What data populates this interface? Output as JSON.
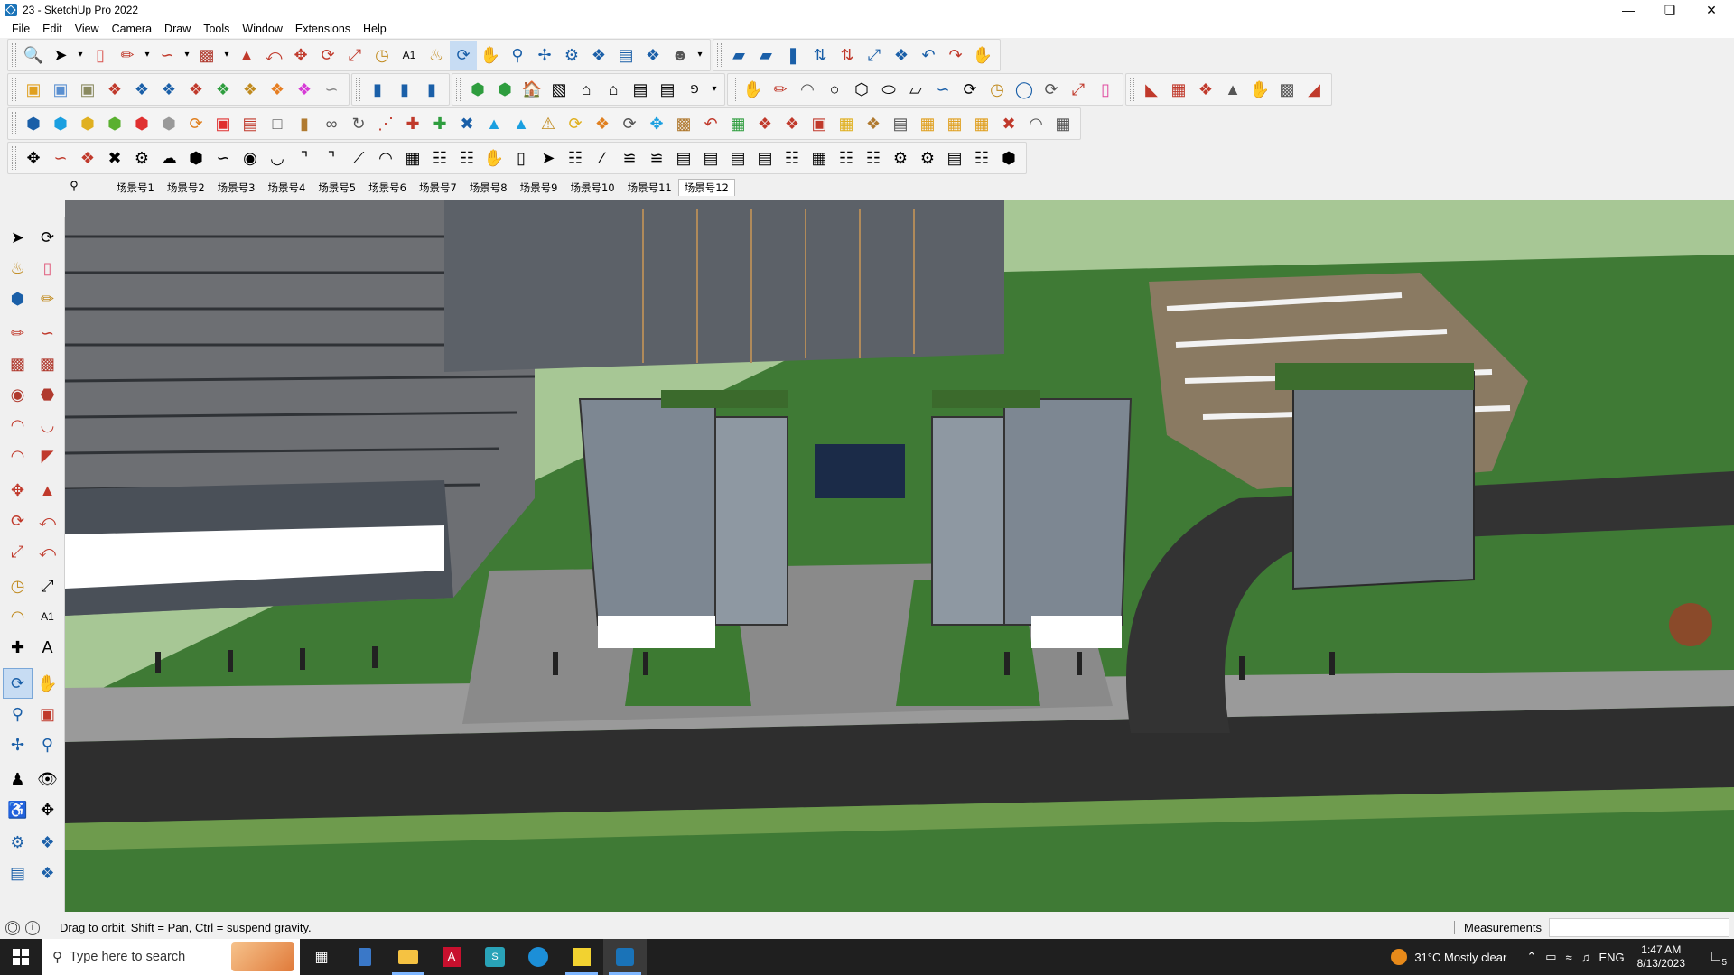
{
  "window": {
    "title": "23 - SketchUp Pro 2022",
    "controls": [
      "minimize-icon",
      "restore-icon",
      "close-icon"
    ]
  },
  "menu": [
    "File",
    "Edit",
    "View",
    "Camera",
    "Draw",
    "Tools",
    "Window",
    "Extensions",
    "Help"
  ],
  "scenes": {
    "search_icon": "search-icon",
    "tabs": [
      "场景号1",
      "场景号2",
      "场景号3",
      "场景号4",
      "场景号5",
      "场景号6",
      "场景号7",
      "场景号8",
      "场景号9",
      "场景号10",
      "场景号11",
      "场景号12"
    ],
    "active": "场景号12"
  },
  "status": {
    "hint": "Drag to orbit. Shift = Pan, Ctrl = suspend gravity.",
    "measurements_label": "Measurements",
    "measurements_value": ""
  },
  "taskbar": {
    "search_placeholder": "Type here to search",
    "apps": [
      "task-view-icon",
      "calculator-icon",
      "file-explorer-icon",
      "acrobat-icon",
      "teams-icon",
      "edge-icon",
      "sticky-notes-icon",
      "sketchup-icon"
    ],
    "weather": "31°C  Mostly clear",
    "language": "ENG",
    "time": "1:47 AM",
    "date": "8/13/2023",
    "notification_count": "5"
  },
  "colors": {
    "sky": "#a7c795",
    "grass": "#3f7a35",
    "road": "#2e2e2e",
    "accent_select": "#c7dcf3"
  }
}
